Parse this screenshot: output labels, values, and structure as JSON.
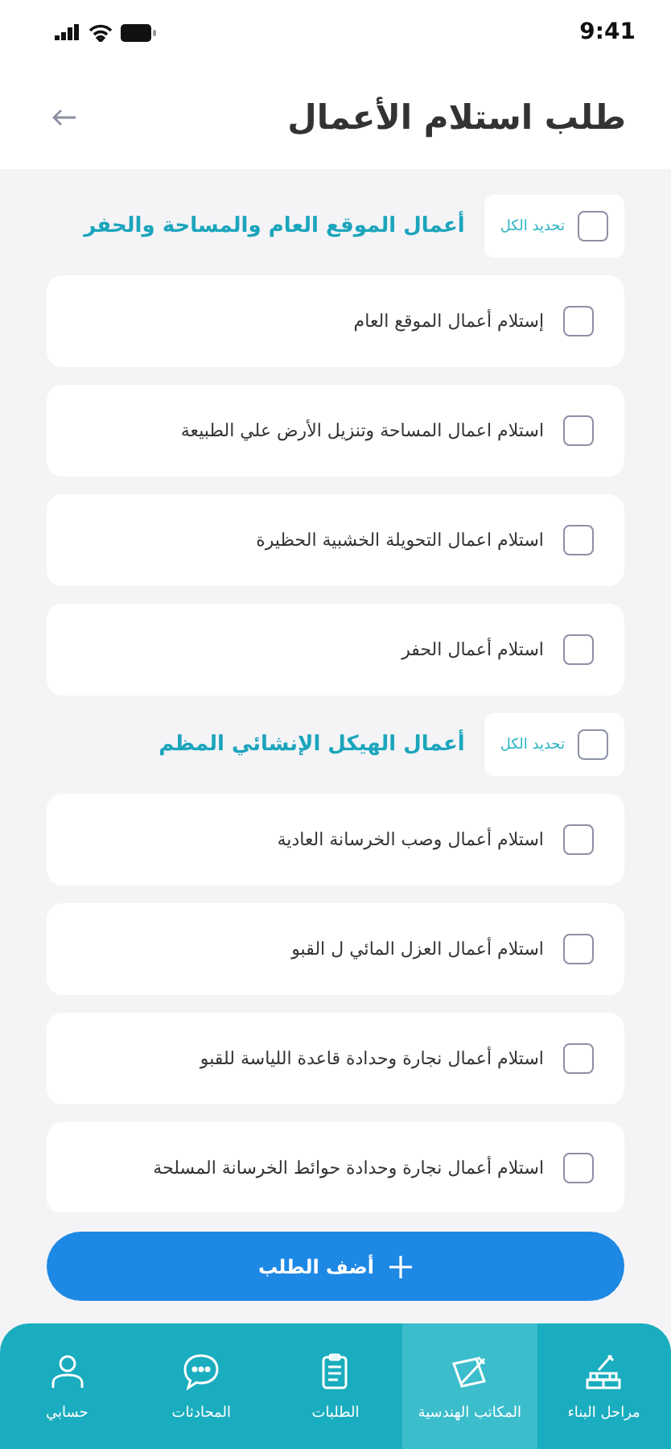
{
  "status_bar": {
    "time": "9:41"
  },
  "header": {
    "title": "طلب استلام الأعمال"
  },
  "sections": [
    {
      "title": "أعمال الموقع العام والمساحة والحفر",
      "select_all": {
        "label": "تحديد الكل",
        "checked": false
      },
      "items": [
        {
          "label": "إستلام أعمال الموقع العام",
          "checked": false
        },
        {
          "label": "استلام اعمال المساحة وتنزيل الأرض علي الطبيعة",
          "checked": false
        },
        {
          "label": "استلام اعمال التحويلة الخشبية الحظيرة",
          "checked": false
        },
        {
          "label": "استلام أعمال الحفر",
          "checked": false
        }
      ]
    },
    {
      "title": "أعمال الهيكل الإنشائي المظم",
      "select_all": {
        "label": "تحديد الكل",
        "checked": false
      },
      "items": [
        {
          "label": "استلام أعمال وصب الخرسانة العادية",
          "checked": false
        },
        {
          "label": "استلام أعمال العزل المائي ل القبو",
          "checked": false
        },
        {
          "label": "استلام أعمال نجارة وحدادة قاعدة اللياسة للقبو",
          "checked": false
        },
        {
          "label": "استلام أعمال نجارة وحدادة حوائط الخرسانة المسلحة",
          "checked": false
        }
      ]
    }
  ],
  "add_button": {
    "label": "أضف الطلب"
  },
  "bottom_nav": [
    {
      "label": "مراحل البناء",
      "selected": false
    },
    {
      "label": "المكاتب الهندسية",
      "selected": true
    },
    {
      "label": "الطلبات",
      "selected": false
    },
    {
      "label": "المحادثات",
      "selected": false
    },
    {
      "label": "حسابي",
      "selected": false
    }
  ]
}
